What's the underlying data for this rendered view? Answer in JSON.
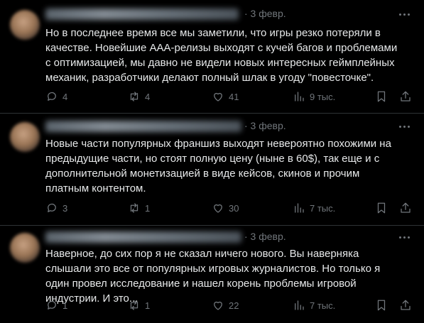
{
  "colors": {
    "background": "#000000",
    "text": "#e7e9ea",
    "muted": "#71767b",
    "divider": "#2f3336"
  },
  "tweets": [
    {
      "author": "",
      "date": "· 3 февр.",
      "text": "Но в последнее время все мы заметили, что игры резко потеряли в качестве. Новейшие AAA-релизы выходят с кучей багов и проблемами с оптимизацией, мы давно не видели новых интересных геймплейных механик, разработчики делают полный шлак в угоду \"повесточке\".",
      "replies": "4",
      "reposts": "4",
      "likes": "41",
      "views": "9 тыс."
    },
    {
      "author": "",
      "date": "· 3 февр.",
      "text": "Новые части популярных франшиз выходят невероятно похожими на предыдущие части, но стоят полную цену (ныне в 60$), так еще и с дополнительной монетизацией в виде кейсов, скинов и прочим платным контентом.",
      "replies": "3",
      "reposts": "1",
      "likes": "30",
      "views": "7 тыс."
    },
    {
      "author": "",
      "date": "· 3 февр.",
      "text": "Наверное, до сих пор я не сказал ничего нового. Вы наверняка слышали это все от популярных игровых журналистов. Но только я один провел исследование и нашел корень проблемы игровой индустрии. И это...",
      "replies": "1",
      "reposts": "1",
      "likes": "22",
      "views": "7 тыс."
    }
  ],
  "icons": [
    "reply-icon",
    "repost-icon",
    "like-icon",
    "views-icon",
    "bookmark-icon",
    "share-icon",
    "more-icon"
  ]
}
